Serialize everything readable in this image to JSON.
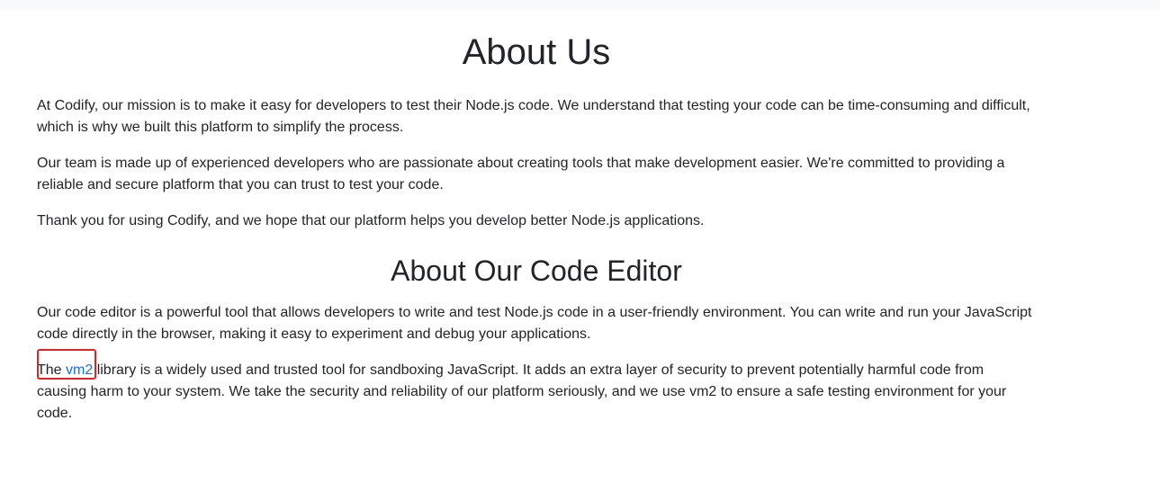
{
  "about": {
    "title": "About Us",
    "paragraphs": [
      "At Codify, our mission is to make it easy for developers to test their Node.js code. We understand that testing your code can be time-consuming and difficult, which is why we built this platform to simplify the process.",
      "Our team is made up of experienced developers who are passionate about creating tools that make development easier. We're committed to providing a reliable and secure platform that you can trust to test your code.",
      "Thank you for using Codify, and we hope that our platform helps you develop better Node.js applications."
    ]
  },
  "editor": {
    "title": "About Our Code Editor",
    "paragraph": "Our code editor is a powerful tool that allows developers to write and test Node.js code in a user-friendly environment. You can write and run your JavaScript code directly in the browser, making it easy to experiment and debug your applications.",
    "vm2_prefix": "The ",
    "vm2_link": "vm2",
    "vm2_suffix": " library is a widely used and trusted tool for sandboxing JavaScript. It adds an extra layer of security to prevent potentially harmful code from causing harm to your system. We take the security and reliability of our platform seriously, and we use vm2 to ensure a safe testing environment for your code."
  },
  "colors": {
    "link": "#0d6efd",
    "highlight": "#e02424",
    "text": "#212529"
  }
}
